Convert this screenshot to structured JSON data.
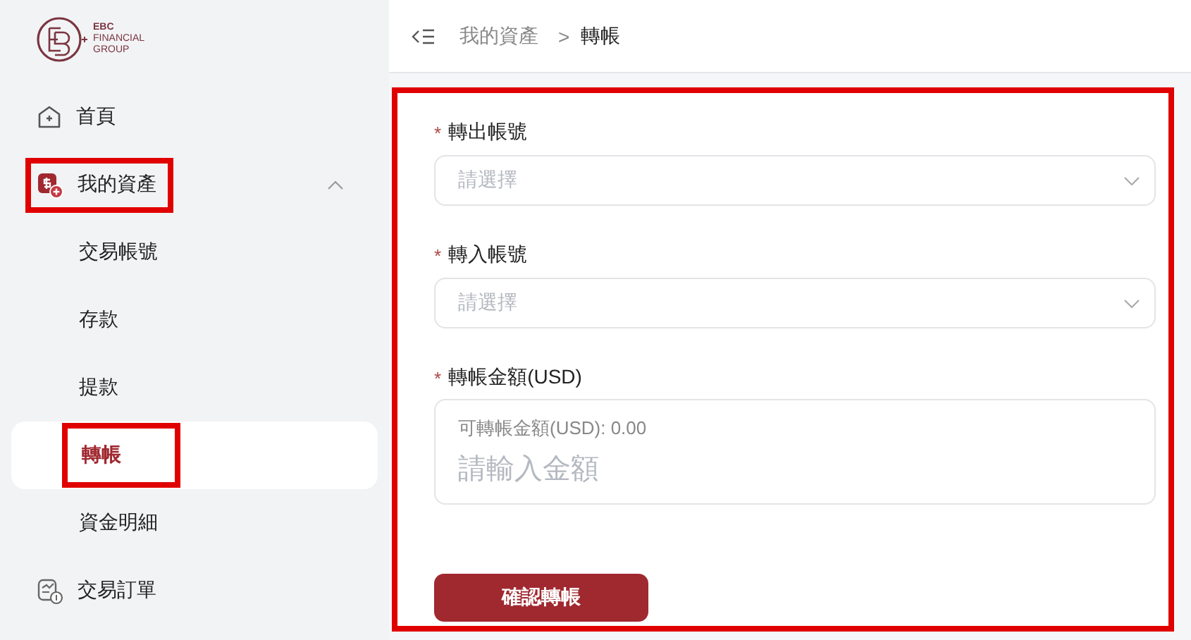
{
  "logo": {
    "line_1": "EBC",
    "line_2": "FINANCIAL",
    "line_3": "GROUP"
  },
  "sidebar": {
    "items": [
      {
        "label": "首頁",
        "kind": "home",
        "selected": false,
        "highlighted": false
      },
      {
        "label": "我的資產",
        "kind": "assets",
        "selected": false,
        "highlighted": true,
        "expanded": true,
        "children": [
          {
            "label": "交易帳號",
            "selected": false,
            "highlighted": false
          },
          {
            "label": "存款",
            "selected": false,
            "highlighted": false
          },
          {
            "label": "提款",
            "selected": false,
            "highlighted": false
          },
          {
            "label": "轉帳",
            "selected": true,
            "highlighted": true
          },
          {
            "label": "資金明細",
            "selected": false,
            "highlighted": false
          }
        ]
      },
      {
        "label": "交易訂單",
        "kind": "orders",
        "selected": false,
        "highlighted": false
      }
    ]
  },
  "breadcrumb": [
    {
      "label": "我的資產",
      "current": false
    },
    {
      "label": "轉帳",
      "current": true
    }
  ],
  "separator": ">",
  "form": {
    "highlighted": true,
    "fields": [
      {
        "kind": "select",
        "label": "轉出帳號",
        "required": true,
        "placeholder": "請選擇"
      },
      {
        "kind": "select",
        "label": "轉入帳號",
        "required": true,
        "placeholder": "請選擇"
      },
      {
        "kind": "amount",
        "label": "轉帳金額(USD)",
        "required": true,
        "hint": "可轉帳金額(USD): 0.00",
        "placeholder": "請輸入金額"
      }
    ],
    "required_mark": "*",
    "submit": "確認轉帳"
  }
}
